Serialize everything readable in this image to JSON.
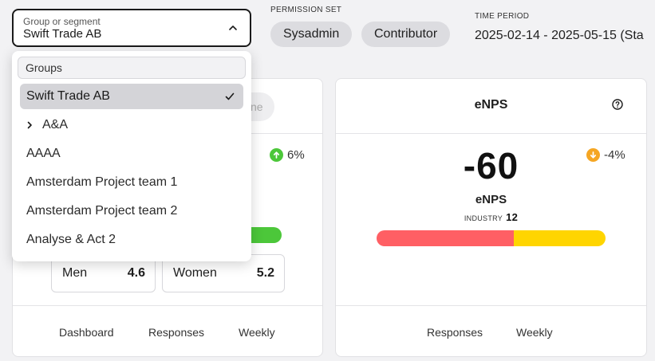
{
  "filter": {
    "label": "Group or segment",
    "value": "Swift Trade AB"
  },
  "permission": {
    "label": "PERMISSION SET",
    "chips": [
      "Sysadmin",
      "Contributor"
    ]
  },
  "time": {
    "label": "TIME PERIOD",
    "value": "2025-02-14 - 2025-05-15 (Sta"
  },
  "left_card": {
    "ghost_text": "ne",
    "trend": "6%",
    "trend_direction": "up",
    "trend_color": "#4cc73a",
    "stats": [
      {
        "name": "Men",
        "value": "4.6"
      },
      {
        "name": "Women",
        "value": "5.2"
      }
    ],
    "footer": [
      "Dashboard",
      "Responses",
      "Weekly"
    ]
  },
  "right_card": {
    "title": "eNPS",
    "value": "-60",
    "label": "eNPS",
    "industry_label": "INDUSTRY",
    "industry_value": "12",
    "trend": "-4%",
    "trend_direction": "down",
    "trend_color": "#f5a623",
    "bar": {
      "red_fraction": 0.6,
      "red_color": "#ff5f64",
      "yellow_color": "#ffd500"
    },
    "footer": [
      "Responses",
      "Weekly"
    ]
  },
  "menu": {
    "header": "Groups",
    "items": [
      {
        "label": "Swift Trade AB",
        "selected": true
      },
      {
        "label": "A&A",
        "expandable": true
      },
      {
        "label": "AAAA"
      },
      {
        "label": "Amsterdam Project team 1"
      },
      {
        "label": "Amsterdam Project team 2"
      },
      {
        "label": "Analyse & Act 2"
      }
    ]
  }
}
